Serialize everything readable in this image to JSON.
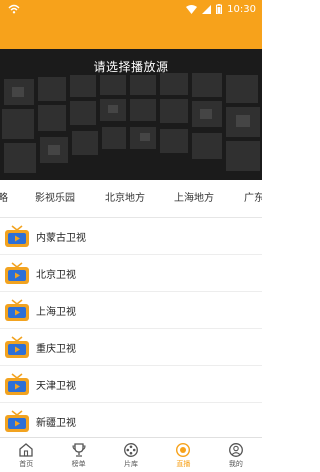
{
  "status": {
    "time": "10:30"
  },
  "hero": {
    "title": "请选择播放源"
  },
  "tabs": [
    "略",
    "影视乐园",
    "北京地方",
    "上海地方",
    "广东"
  ],
  "channels": [
    "内蒙古卫视",
    "北京卫视",
    "上海卫视",
    "重庆卫视",
    "天津卫视",
    "新疆卫视"
  ],
  "nav": [
    {
      "label": "首页",
      "icon": "home-icon"
    },
    {
      "label": "榜单",
      "icon": "trophy-icon"
    },
    {
      "label": "片库",
      "icon": "film-reel-icon"
    },
    {
      "label": "直播",
      "icon": "live-icon",
      "active": true
    },
    {
      "label": "我的",
      "icon": "user-icon"
    }
  ],
  "colors": {
    "accent": "#f7a21b",
    "tv_icon": "#f2a320",
    "tv_screen": "#2d6fd6"
  }
}
